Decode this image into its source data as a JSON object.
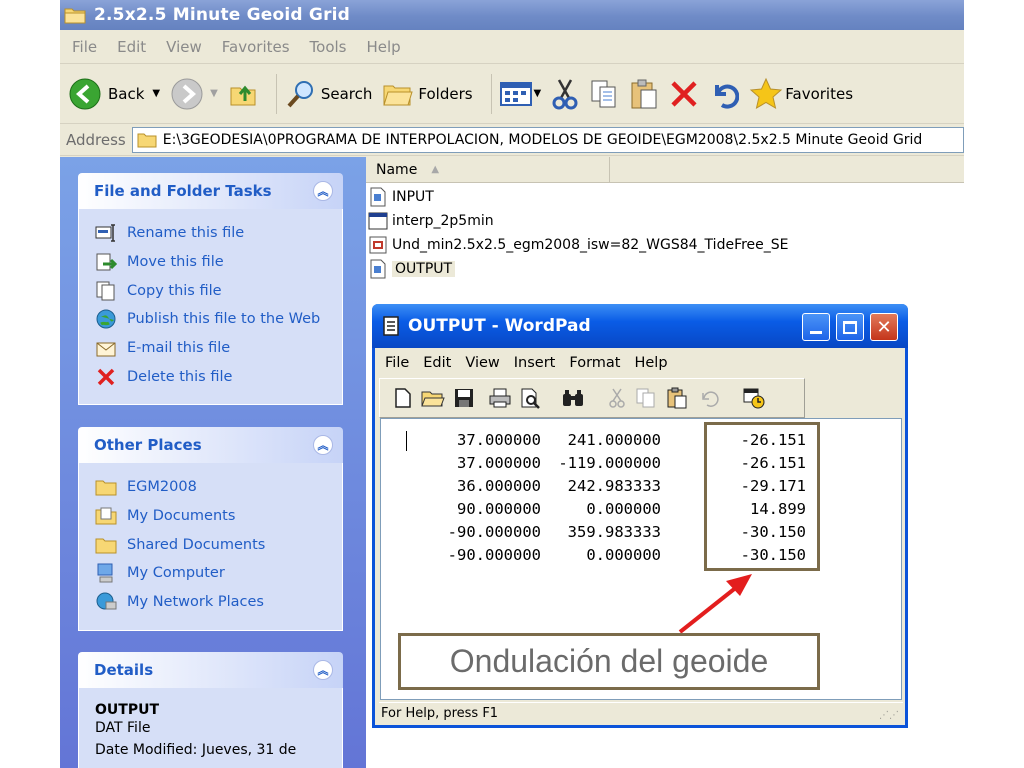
{
  "explorer": {
    "title": "2.5x2.5 Minute Geoid Grid",
    "menu": [
      "File",
      "Edit",
      "View",
      "Favorites",
      "Tools",
      "Help"
    ],
    "toolbar": {
      "back_label": "Back",
      "search_label": "Search",
      "folders_label": "Folders",
      "favorites_label": "Favorites"
    },
    "address": {
      "label": "Address",
      "value": "E:\\3GEODESIA\\0PROGRAMA DE INTERPOLACION, MODELOS DE GEOIDE\\EGM2008\\2.5x2.5 Minute Geoid Grid"
    }
  },
  "taskpane": {
    "file_tasks": {
      "title": "File and Folder Tasks",
      "items": [
        {
          "label": "Rename this file",
          "icon": "rename-icon"
        },
        {
          "label": "Move this file",
          "icon": "move-icon"
        },
        {
          "label": "Copy this file",
          "icon": "copy-icon"
        },
        {
          "label": "Publish this file to the Web",
          "icon": "globe-icon"
        },
        {
          "label": "E-mail this file",
          "icon": "email-icon"
        },
        {
          "label": "Delete this file",
          "icon": "delete-icon"
        }
      ]
    },
    "other_places": {
      "title": "Other Places",
      "items": [
        {
          "label": "EGM2008",
          "icon": "folder-icon"
        },
        {
          "label": "My Documents",
          "icon": "documents-icon"
        },
        {
          "label": "Shared Documents",
          "icon": "folder-icon"
        },
        {
          "label": "My Computer",
          "icon": "computer-icon"
        },
        {
          "label": "My Network Places",
          "icon": "network-icon"
        }
      ]
    },
    "details": {
      "title": "Details",
      "name": "OUTPUT",
      "type": "DAT File",
      "date": "Date Modified: Jueves, 31 de"
    }
  },
  "filelist": {
    "column_name": "Name",
    "files": [
      {
        "name": "INPUT",
        "icon": "dat-file-icon"
      },
      {
        "name": "interp_2p5min",
        "icon": "exe-file-icon"
      },
      {
        "name": "Und_min2.5x2.5_egm2008_isw=82_WGS84_TideFree_SE",
        "icon": "grid-file-icon"
      },
      {
        "name": "OUTPUT",
        "icon": "dat-file-icon"
      }
    ]
  },
  "wordpad": {
    "title": "OUTPUT - WordPad",
    "menu": [
      "File",
      "Edit",
      "View",
      "Insert",
      "Format",
      "Help"
    ],
    "status": "For Help, press F1",
    "rows": [
      [
        "37.000000",
        "241.000000",
        "-26.151"
      ],
      [
        "37.000000",
        "-119.000000",
        "-26.151"
      ],
      [
        "36.000000",
        "242.983333",
        "-29.171"
      ],
      [
        "90.000000",
        "0.000000",
        "14.899"
      ],
      [
        "-90.000000",
        "359.983333",
        "-30.150"
      ],
      [
        "-90.000000",
        "0.000000",
        "-30.150"
      ]
    ]
  },
  "annotation": {
    "label": "Ondulación del geoide",
    "color": "#7b6b4a",
    "arrow_color": "#e31e1e"
  }
}
